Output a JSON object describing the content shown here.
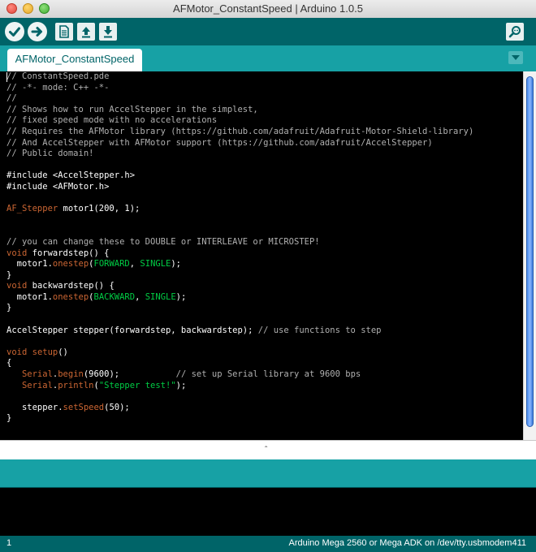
{
  "window": {
    "title": "AFMotor_ConstantSpeed | Arduino 1.0.5"
  },
  "toolbar": {
    "buttons": [
      {
        "name": "verify",
        "icon": "checkmark-icon"
      },
      {
        "name": "upload",
        "icon": "arrow-right-icon"
      },
      {
        "name": "new",
        "icon": "document-icon"
      },
      {
        "name": "open",
        "icon": "arrow-up-icon"
      },
      {
        "name": "save",
        "icon": "arrow-down-icon"
      },
      {
        "name": "serial-monitor",
        "icon": "magnifier-icon"
      }
    ]
  },
  "tabs": [
    {
      "label": "AFMotor_ConstantSpeed",
      "active": true
    }
  ],
  "editor": {
    "lines": [
      [
        {
          "t": "// ConstantSpeed.pde",
          "c": "comment"
        }
      ],
      [
        {
          "t": "// -*- mode: C++ -*-",
          "c": "comment"
        }
      ],
      [
        {
          "t": "//",
          "c": "comment"
        }
      ],
      [
        {
          "t": "// Shows how to run AccelStepper in the simplest,",
          "c": "comment"
        }
      ],
      [
        {
          "t": "// fixed speed mode with no accelerations",
          "c": "comment"
        }
      ],
      [
        {
          "t": "// Requires the AFMotor library (https://github.com/adafruit/Adafruit-Motor-Shield-library)",
          "c": "comment"
        }
      ],
      [
        {
          "t": "// And AccelStepper with AFMotor support (https://github.com/adafruit/AccelStepper)",
          "c": "comment"
        }
      ],
      [
        {
          "t": "// Public domain!",
          "c": "comment"
        }
      ],
      [],
      [
        {
          "t": "#include <AccelStepper.h>",
          "c": "plain"
        }
      ],
      [
        {
          "t": "#include <AFMotor.h>",
          "c": "plain"
        }
      ],
      [],
      [
        {
          "t": "AF_Stepper",
          "c": "orange"
        },
        {
          "t": " motor1(200, 1);",
          "c": "plain"
        }
      ],
      [],
      [],
      [
        {
          "t": "// you can change these to DOUBLE or INTERLEAVE or MICROSTEP!",
          "c": "comment"
        }
      ],
      [
        {
          "t": "void",
          "c": "orange"
        },
        {
          "t": " forwardstep() {",
          "c": "plain"
        }
      ],
      [
        {
          "t": "  motor1.",
          "c": "plain"
        },
        {
          "t": "onestep",
          "c": "orange"
        },
        {
          "t": "(",
          "c": "plain"
        },
        {
          "t": "FORWARD",
          "c": "green"
        },
        {
          "t": ", ",
          "c": "plain"
        },
        {
          "t": "SINGLE",
          "c": "green"
        },
        {
          "t": ");",
          "c": "plain"
        }
      ],
      [
        {
          "t": "}",
          "c": "plain"
        }
      ],
      [
        {
          "t": "void",
          "c": "orange"
        },
        {
          "t": " backwardstep() {",
          "c": "plain"
        }
      ],
      [
        {
          "t": "  motor1.",
          "c": "plain"
        },
        {
          "t": "onestep",
          "c": "orange"
        },
        {
          "t": "(",
          "c": "plain"
        },
        {
          "t": "BACKWARD",
          "c": "green"
        },
        {
          "t": ", ",
          "c": "plain"
        },
        {
          "t": "SINGLE",
          "c": "green"
        },
        {
          "t": ");",
          "c": "plain"
        }
      ],
      [
        {
          "t": "}",
          "c": "plain"
        }
      ],
      [],
      [
        {
          "t": "AccelStepper stepper(forwardstep, backwardstep); ",
          "c": "plain"
        },
        {
          "t": "// use functions to step",
          "c": "comment"
        }
      ],
      [],
      [
        {
          "t": "void",
          "c": "orange"
        },
        {
          "t": " ",
          "c": "plain"
        },
        {
          "t": "setup",
          "c": "orange"
        },
        {
          "t": "()",
          "c": "plain"
        }
      ],
      [
        {
          "t": "{",
          "c": "plain"
        }
      ],
      [
        {
          "t": "   ",
          "c": "plain"
        },
        {
          "t": "Serial",
          "c": "orange"
        },
        {
          "t": ".",
          "c": "plain"
        },
        {
          "t": "begin",
          "c": "orange"
        },
        {
          "t": "(9600);           ",
          "c": "plain"
        },
        {
          "t": "// set up Serial library at 9600 bps",
          "c": "comment"
        }
      ],
      [
        {
          "t": "   ",
          "c": "plain"
        },
        {
          "t": "Serial",
          "c": "orange"
        },
        {
          "t": ".",
          "c": "plain"
        },
        {
          "t": "println",
          "c": "orange"
        },
        {
          "t": "(",
          "c": "plain"
        },
        {
          "t": "\"Stepper test!\"",
          "c": "green"
        },
        {
          "t": ");",
          "c": "plain"
        }
      ],
      [],
      [
        {
          "t": "   stepper.",
          "c": "plain"
        },
        {
          "t": "setSpeed",
          "c": "orange"
        },
        {
          "t": "(50);",
          "c": "plain"
        }
      ],
      [
        {
          "t": "}",
          "c": "plain"
        }
      ]
    ]
  },
  "status": {
    "line_number": "1",
    "board": "Arduino Mega 2560 or Mega ADK on /dev/tty.usbmodem411"
  }
}
